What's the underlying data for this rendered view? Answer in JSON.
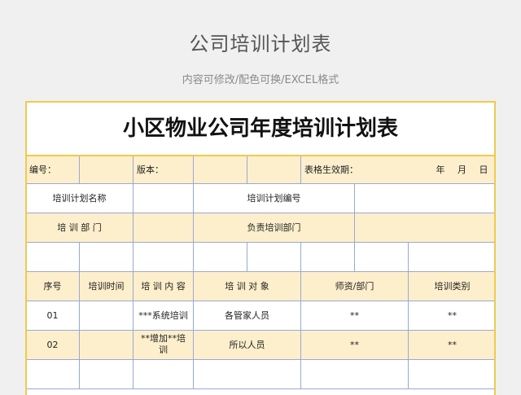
{
  "header": {
    "title": "公司培训计划表",
    "subtitle": "内容可修改/配色可换/EXCEL格式"
  },
  "sheet": {
    "title": "小区物业公司年度培训计划表",
    "info_row": {
      "number_label": "编号：",
      "version_label": "版本：",
      "effective_date_label": "表格生效期：",
      "date_placeholder": "年   月   日"
    },
    "plan_name_label": "培训计划名称",
    "plan_number_label": "培训计划编号",
    "department_label": "培 训 部 门",
    "responsible_department_label": "负责培训部门",
    "columns": [
      "序号",
      "培训时间",
      "培 训 内 容",
      "培 训 对 象",
      "师资/部门",
      "培训类别"
    ],
    "rows": [
      {
        "no": "01",
        "time": "",
        "content": "***系统培训",
        "target": "各管家人员",
        "teacher": "**",
        "category": "**"
      },
      {
        "no": "02",
        "time": "",
        "content": "**增加**培训",
        "target": "所以人员",
        "teacher": "**",
        "category": "**"
      }
    ]
  }
}
